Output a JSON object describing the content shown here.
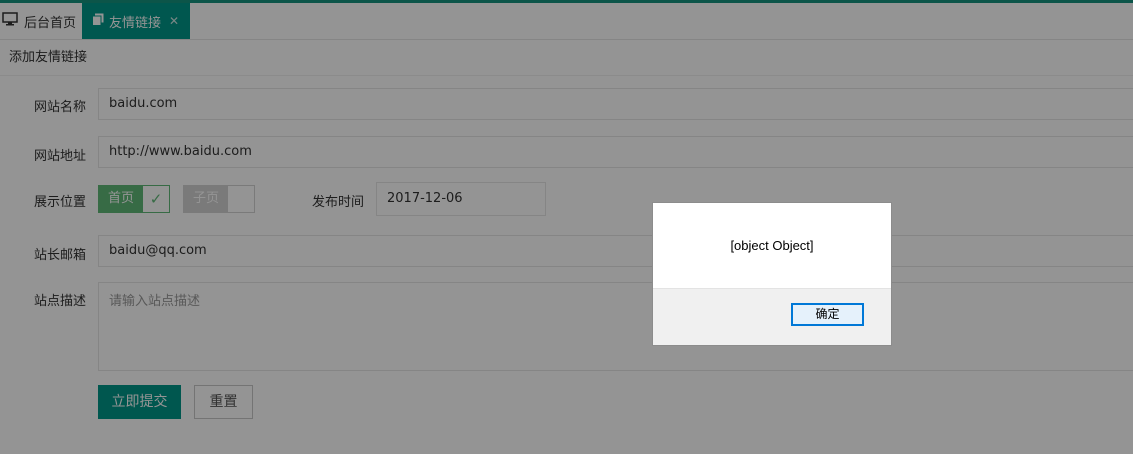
{
  "tabs": [
    {
      "label": "后台首页",
      "icon": "monitor-icon"
    },
    {
      "label": "友情链接",
      "icon": "copy-icon",
      "close": "✕"
    }
  ],
  "form": {
    "title": "添加友情链接",
    "name_label": "网站名称",
    "name_value": "baidu.com",
    "url_label": "网站地址",
    "url_value": "http://www.baidu.com",
    "position_label": "展示位置",
    "position_home": "首页",
    "position_sub": "子页",
    "publish_label": "发布时间",
    "publish_value": "2017-12-06",
    "email_label": "站长邮箱",
    "email_value": "baidu@qq.com",
    "desc_label": "站点描述",
    "desc_placeholder": "请输入站点描述",
    "submit": "立即提交",
    "reset": "重置"
  },
  "dialog": {
    "message": "[object Object]",
    "ok": "确定"
  }
}
